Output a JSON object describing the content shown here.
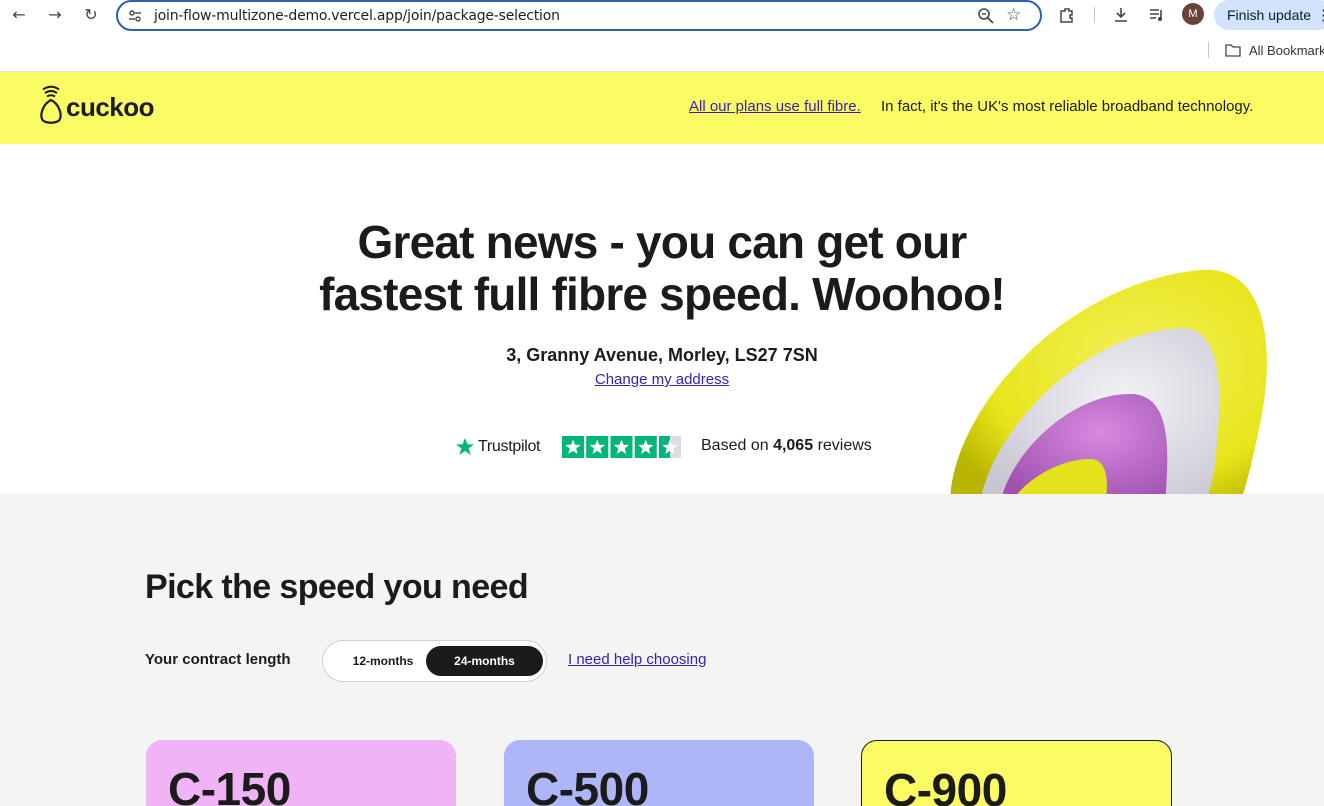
{
  "browser": {
    "url": "join-flow-multizone-demo.vercel.app/join/package-selection",
    "avatar_initial": "M",
    "finish_update_label": "Finish update",
    "bookmarks_label": "All Bookmarks"
  },
  "banner": {
    "logo_text": "cuckoo",
    "link_text": "All our plans use full fibre.",
    "tagline": "In fact, it's the UK's most reliable broadband technology.",
    "background_color": "#fbfc63"
  },
  "hero": {
    "heading_line1": "Great news - you can get our",
    "heading_line2": "fastest full fibre speed. Woohoo!",
    "address": "3, Granny Avenue, Morley, LS27 7SN",
    "change_address_label": "Change my address",
    "trustpilot_name": "Trustpilot",
    "rating_stars": 4.5,
    "reviews_prefix": "Based on",
    "reviews_count": "4,065",
    "reviews_suffix": "reviews"
  },
  "packages": {
    "title": "Pick the speed you need",
    "contract_label": "Your contract length",
    "contract_options": [
      "12-months",
      "24-months"
    ],
    "contract_selected": "24-months",
    "help_link": "I need help choosing",
    "plans": [
      {
        "name": "C-150",
        "color": "#f0b3f5"
      },
      {
        "name": "C-500",
        "color": "#aeb6f7"
      },
      {
        "name": "C-900",
        "color": "#fbfc63"
      }
    ]
  }
}
